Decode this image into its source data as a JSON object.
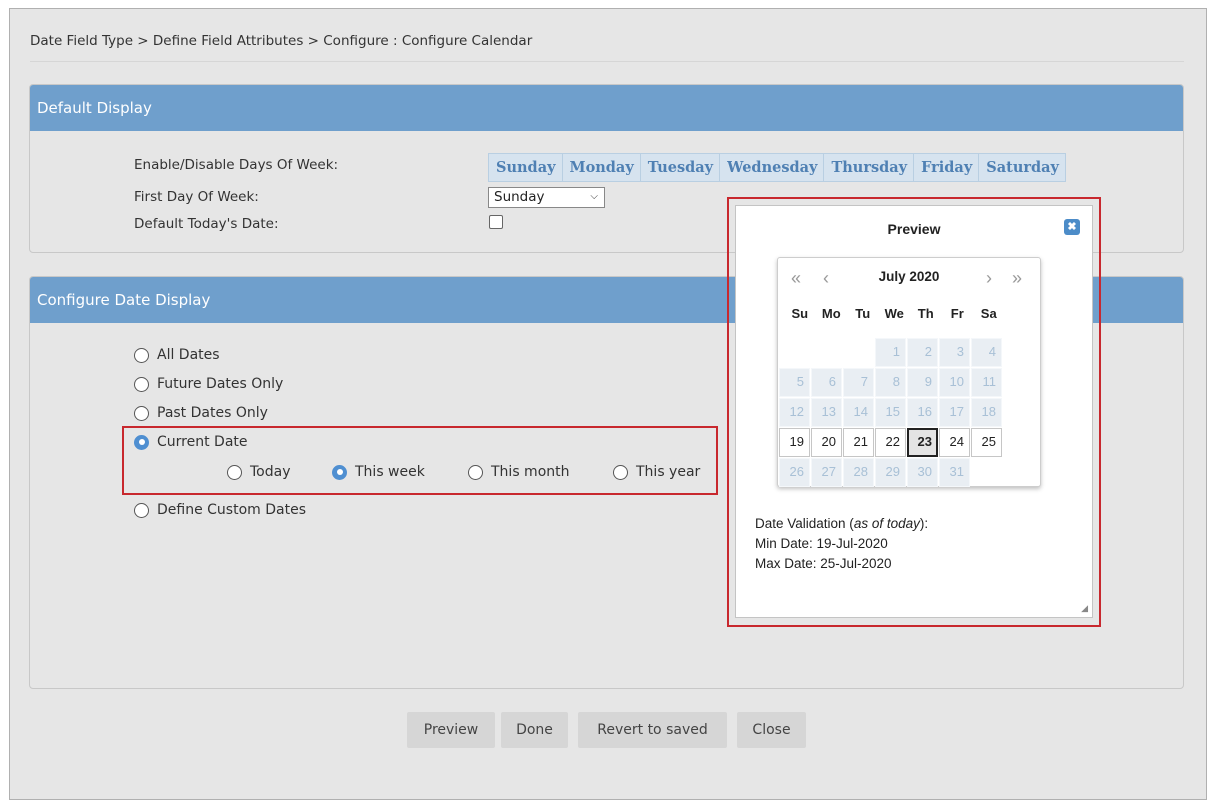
{
  "breadcrumb": "Date Field Type > Define Field Attributes > Configure : Configure Calendar",
  "default_display": {
    "title": "Default Display",
    "enable_days_label": "Enable/Disable Days Of Week:",
    "days": [
      "Sunday",
      "Monday",
      "Tuesday",
      "Wednesday",
      "Thursday",
      "Friday",
      "Saturday"
    ],
    "first_day_label": "First Day Of Week:",
    "first_day_value": "Sunday",
    "default_today_label": "Default Today's Date:",
    "default_today_checked": false
  },
  "configure_date_display": {
    "title": "Configure Date Display",
    "options": {
      "all_dates": "All Dates",
      "future_dates": "Future Dates Only",
      "past_dates": "Past Dates Only",
      "current_date": "Current Date",
      "custom_dates": "Define Custom Dates"
    },
    "selected": "Current Date",
    "sub_options": {
      "today": "Today",
      "this_week": "This week",
      "this_month": "This month",
      "this_year": "This year"
    },
    "sub_selected": "This week"
  },
  "buttons": {
    "preview": "Preview",
    "done": "Done",
    "revert": "Revert to saved",
    "close": "Close"
  },
  "preview_dialog": {
    "title": "Preview",
    "close_glyph": "✖",
    "calendar": {
      "month_label": "July 2020",
      "nav_first": "«",
      "nav_prev": "‹",
      "nav_next": "›",
      "nav_last": "»",
      "weekdays": [
        "Su",
        "Mo",
        "Tu",
        "We",
        "Th",
        "Fr",
        "Sa"
      ],
      "leading_blanks": 3,
      "days_in_month": 31,
      "enabled_range": [
        19,
        25
      ],
      "today": 23
    },
    "validation_label": "Date Validation (",
    "validation_em": "as of today",
    "validation_end": "):",
    "min_date": "Min Date: 19-Jul-2020",
    "max_date": "Max Date: 25-Jul-2020"
  },
  "colors": {
    "panel_header": "#6f9fcc",
    "highlight_border": "#c8282e",
    "radio_selected": "#4f8fd1",
    "day_text": "#4f80b3"
  }
}
